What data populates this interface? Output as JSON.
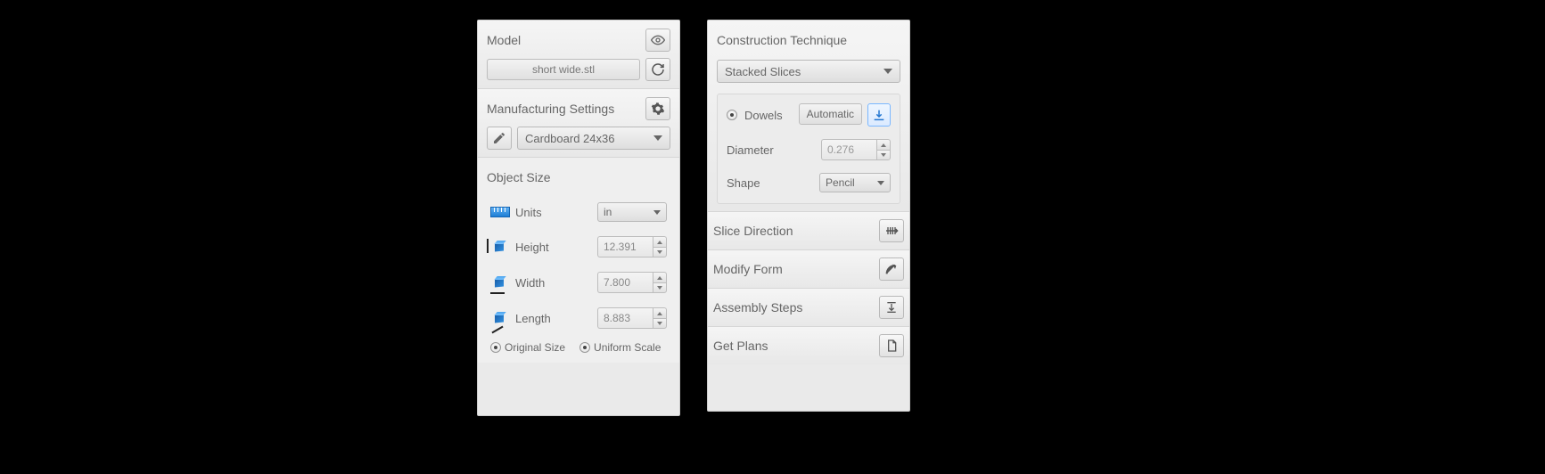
{
  "model": {
    "title": "Model",
    "filename": "short wide.stl"
  },
  "manufacturing": {
    "title": "Manufacturing Settings",
    "material": "Cardboard 24x36"
  },
  "objectSize": {
    "title": "Object Size",
    "unitsLabel": "Units",
    "unitsValue": "in",
    "heightLabel": "Height",
    "heightValue": "12.391",
    "widthLabel": "Width",
    "widthValue": "7.800",
    "lengthLabel": "Length",
    "lengthValue": "8.883",
    "originalSize": "Original Size",
    "uniformScale": "Uniform Scale"
  },
  "construction": {
    "title": "Construction Technique",
    "technique": "Stacked Slices",
    "dowelsLabel": "Dowels",
    "dowelsMode": "Automatic",
    "diameterLabel": "Diameter",
    "diameterValue": "0.276",
    "shapeLabel": "Shape",
    "shapeValue": "Pencil"
  },
  "sliceDirection": {
    "title": "Slice Direction"
  },
  "modifyForm": {
    "title": "Modify Form"
  },
  "assemblySteps": {
    "title": "Assembly Steps"
  },
  "getPlans": {
    "title": "Get Plans"
  }
}
